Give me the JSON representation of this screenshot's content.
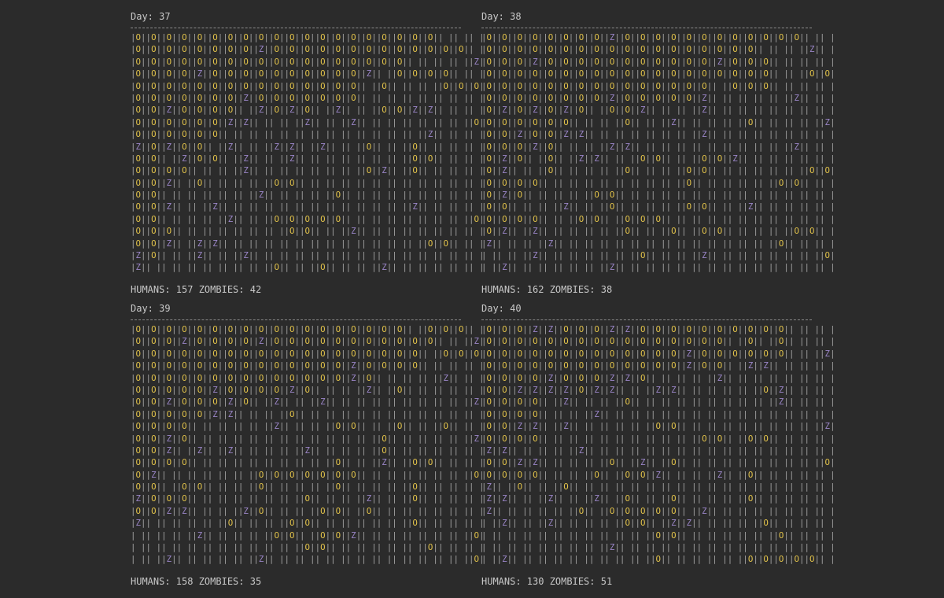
{
  "panels": [
    {
      "day_label": "Day: 37",
      "stats": "HUMANS: 157 ZOMBIES: 42",
      "rows": [
        "|O||O||O||O||O||O||O||O||O||O||O||O||O||O||O||O||O||O||O||O|| || || |",
        "|O||O||O||O||O||O||O||O||Z||O||O||O||O||O||O||O||O||O||O||O||O||O|| |",
        "|O||O||O||O||O||O||O||O||O||O||O||O||O||O||O||O||O||O|| || || || ||Z|",
        "|O||O||O||O||Z||O||O||O||O||O||O||O||O||O||O||Z|| ||O||O||O||O|| || |",
        "|O||O||O||O||O||O||O||O||O||O||O||O||O||O||O|| ||O|| || || ||O||O||O|",
        "|O||O||O||O||O||O||O||Z||O||O||O||O||O||O||O|| || || || || || || || |",
        "|O||O||Z||O||O||O||O|| ||Z||O||Z||O|| ||Z|| || ||O||O||Z||Z|| || || |",
        "|O||O||O||O||O||O||Z||Z|| || || ||Z|| || ||Z|| || || || || || || ||O|",
        "|O||O||O||O||O||O|| || || || || || || || || || || || || ||Z|| || || |",
        "|Z||O||Z||O||O|| ||Z|| || ||Z||Z|| ||Z|| || ||O|| || ||O|| || || || |",
        "|O||O|| ||Z||O||O|| ||Z|| || ||Z|| || || || || || || ||O||O|| || || |",
        "|O||O||O||O|| || || ||Z|| || || || || || || ||O||Z|| ||O|| || || || |",
        "|O||O||Z|| ||O|| || || || ||O||O|| || || || || || || || || || || || |",
        "|O||O|| || || || || || ||Z|| || || || ||O|| || || || || || || || || |",
        "|O||O||Z|| || ||Z|| || || || || || || || || || || || ||Z|| || || || |",
        "|O||O|| || || || ||Z|| || ||O||O||O||O||O|| || || || || || || || ||O|",
        "|O||O||O|| || || || || || || ||O||O|| || ||Z|| || || || || || || || |",
        "|O||O||Z|| ||Z||Z|| || || || || || || || || || || || || ||O||O|| || |",
        "|Z||O|| || ||Z|| || ||Z|| || || || || || || || || || || || || || || |",
        "|Z|| || || || || || || || ||O|| || ||O|| || || ||Z|| || || || || || |"
      ]
    },
    {
      "day_label": "Day: 38",
      "stats": "HUMANS: 162 ZOMBIES: 38",
      "rows": [
        "|O||O||O||O||O||O||O||O||Z||O||O||O||O||O||O||O||O||O||O||O||O|| || |",
        "|O||O||O||O||O||O||O||O||O||O||O||O||O||O||O||O||O||O|| || || ||Z|| |",
        "|O||O||O||Z||O||O||O||O||O||O||O||O||O||O||O||Z||O||O||O|| || || || |",
        "|O||O||O||O||O||O||O||O||O||O||O||O||O||O||O||O||O||O||O|| || ||O||O|",
        "|O||O||O||O||O||O||O||O||O||O||O||O||O||O||O|| ||O||O||O|| || || || |",
        "|O||O||O||O||O||O||O||O||Z||O||O||O||O||O||Z|| || || || || ||Z|| || |",
        "|O||Z||O||Z||O||Z||O|| ||O||O||Z|| || || ||Z|| || || || || || || || |",
        "|O||O||O||O||O||O|| || || ||O|| || ||Z|| || || || ||O|| || || || ||Z|",
        "|O||O||Z||O||O||Z||Z|| || || || || || || ||Z|| || || || || || || || |",
        "|O||O||O||Z||O|| || || ||Z||Z|| || || || || || || || || || ||Z|| || |",
        "|O||Z||O|| ||O|| ||Z||Z|| || ||O||O|| || ||O||O||Z|| || || || || || |",
        "|O||Z|| || ||O|| || || || ||O|| || || ||O||O|| || || || || || ||O||O|",
        "|O||O||O||O|| || || || || || || || || ||O|| || || || || ||O||O|| || |",
        "|O||Z||O|| || || || ||O||O|| || || || || || || || || || || || || || |",
        "|O||O|| || || ||Z|| || ||O|| || || || ||O||O|| || ||Z|| || || || || |",
        "|O||O||O||O|| || ||O||O|| ||O||O||O|| || || || || || || || || || || |",
        "|O||Z|| ||Z|| || || || || ||O|| || ||O|| ||O||O|| || || || ||O||O|| |",
        "|Z|| || || ||Z|| || || || || || || || || || || || || || ||O|| || || |",
        "| || || ||Z|| || || || || || ||O|| || || ||Z|| || || || || || || ||O|",
        "| ||Z|| || || || || || ||Z|| || || || || || || || || || || || || || |"
      ]
    },
    {
      "day_label": "Day: 39",
      "stats": "HUMANS: 158 ZOMBIES: 35",
      "rows": [
        "|O||O||O||O||O||O||O||O||O||O||O||O||O||O||O||O||O||O|| ||O||O||O|| |",
        "|O||O||O||Z||O||O||O||O||Z||O||O||O||O||O||O||O||O||O||O||O|| || ||Z|",
        "|O||O||O||O||O||O||O||O||O||O||O||O||O||O||O||O||O||O||O|| ||O||O||O|",
        "|O||O||O||O||O||O||O||O||O||O||O||O||O||O||Z||O||O||O||O|| || || || |",
        "|O||O||O||O||O||O||O||O||O||O||O||O||O||O||Z||O|| || || || ||Z|| || |",
        "|O||O||O||O||O||Z||O||O||O||O||Z||O|| || || ||Z|| ||O|| || || || || |",
        "|O||O||Z||O||O||O||Z||O|| ||Z|| || ||Z|| || || || || || || || || ||Z|",
        "|O||O||O||O||O||Z||Z|| || || ||O|| || || || || || || || || || || || |",
        "|O||O||O||O|| || || || || ||Z|| || || ||O||O|| || ||O|| || ||O|| || |",
        "|O||O||Z||O|| || || || || || || || || || || || ||O|| || || || || ||Z|",
        "|O||O||Z|| ||Z|| ||Z|| || || || ||Z|| || || || ||O|| || || || || || |",
        "|O||O||O||O|| || || || || || || || || ||O|| || ||Z|| ||O||O|| || || |",
        "|O||Z|| || || || || || ||O||O||O||O||O||O||O|| || || || || || || ||O|",
        "|O||O|| ||O||O|| || || ||O|| || || || ||O|| || || || ||O|| || || || |",
        "|Z||O||O||O|| || || || || || || ||O|| || || ||Z|| || ||O|| || || || |",
        "|O||O||Z||Z|| || || ||Z||O|| || || ||O||O|| ||O|| || || || || || || |",
        "|Z|| || || || || ||O|| || || ||O||O|| || || || || || ||O|| || || || |",
        "| || || || ||Z|| || || || ||O||O|| ||O||O||Z|| || || || || || || ||O|",
        "| || || || || || || || || || || ||O||O|| || || || || || ||O|| || || |",
        "| || ||Z|| || || || || ||Z|| || || || || || || || || || || || || ||O|"
      ]
    },
    {
      "day_label": "Day: 40",
      "stats": "HUMANS: 130 ZOMBIES: 51",
      "rows": [
        "|O||O||O||Z||Z||O||O||O||Z||Z||O||O||O||O||O||O||O||O||O||O|| || || |",
        "|O||O||O||O||O||O||O||O||O||O||O||O||O||O||O||O|| ||O|| ||O|| || || |",
        "|O||O||O||O||O||O||O||O||O||O||O||O||O||Z||O||O||O||O||O||O|| || ||Z|",
        "|O||O||O||O||O||O||O||O||O||O||O||O||O||Z||O||O|| ||Z||Z|| || || || |",
        "|O||O||O||O||Z||O||O||O||Z||Z||O|| || || || ||Z|| || || || || || || |",
        "|O||O||Z||Z||Z||Z||O||Z||Z|| || ||Z||Z|| || || || || ||O||Z|| || || |",
        "|O||O||O||O|| ||Z|| || || ||O|| || || || || || || || || ||Z|| || || |",
        "|O||O||O||O|| || || ||Z|| || || || || || || || || || || || || || || |",
        "|O||O||Z||Z|| ||Z|| || || || || ||O||O|| || || || || || || || || ||Z|",
        "|O||O||O||O|| || || || || || || || || || ||O||O|| ||O||O|| || || || |",
        "|Z||Z|| || || || ||Z|| || || || || || || || || || || || || || || || |",
        "|O||O||Z||Z|| || || || ||O|| ||Z|| ||O|| || || || || || || || || ||O|",
        "|O||O||O||O|| || || ||O|| ||O||O||Z|| || || ||Z|| ||O|| || || || || |",
        "|Z|| ||O|| || ||O|| || || || || || || || || || || || || || || || || |",
        "|Z||Z|| || ||Z|| || ||Z|| ||O|| || ||O|| || || || ||O|| || || || || |",
        "|Z|| || || || || ||O|| ||O||O||O||O||O|| ||Z|| || || || || || || || |",
        "| ||Z|| || ||Z|| || || || ||O||O|| ||Z||Z|| || || || ||O|| || || || |",
        "| || || || || || || || || || || ||O||O|| || || || || || ||O|| || || |",
        "| || || || || || || || ||Z|| || || || || || || || || || || || || || |",
        "| ||Z|| || || || || || || || || ||O|| || || || || ||O||O||O||O||O|| |"
      ]
    }
  ]
}
